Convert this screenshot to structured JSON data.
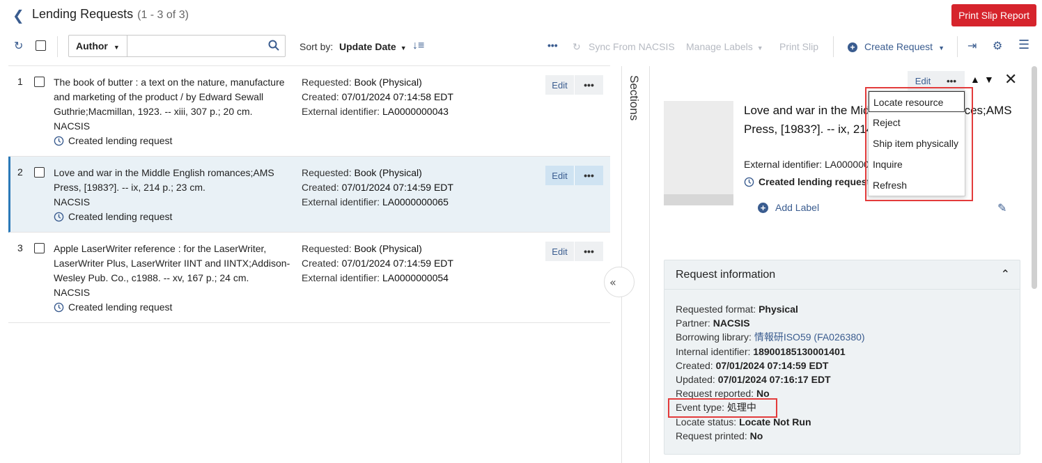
{
  "header": {
    "title": "Lending Requests",
    "count": "(1 - 3 of 3)",
    "print_report": "Print Slip Report"
  },
  "toolbar": {
    "search_field": "Author",
    "search_placeholder": "",
    "sort_label": "Sort by:",
    "sort_value": "Update Date",
    "sync": "Sync From NACSIS",
    "manage_labels": "Manage Labels",
    "print_slip": "Print Slip",
    "create_request": "Create Request"
  },
  "rows": [
    {
      "num": "1",
      "title": "The book of butter : a text on the nature, manufacture and marketing of the product / by Edward Sewall Guthrie;Macmillan, 1923. -- xiii, 307 p.; 20 cm.",
      "source": "NACSIS",
      "event": "Created lending request",
      "requested_label": "Requested:",
      "requested": "Book (Physical)",
      "created_label": "Created:",
      "created": "07/01/2024 07:14:58 EDT",
      "ext_label": "External identifier:",
      "ext": "LA0000000043",
      "edit": "Edit",
      "more": "•••"
    },
    {
      "num": "2",
      "title": "Love and war in the Middle English romances;AMS Press, [1983?]. -- ix, 214 p.; 23 cm.",
      "source": "NACSIS",
      "event": "Created lending request",
      "requested_label": "Requested:",
      "requested": "Book (Physical)",
      "created_label": "Created:",
      "created": "07/01/2024 07:14:59 EDT",
      "ext_label": "External identifier:",
      "ext": "LA0000000065",
      "edit": "Edit",
      "more": "•••"
    },
    {
      "num": "3",
      "title": "Apple LaserWriter reference : for the LaserWriter, LaserWriter Plus, LaserWriter IINT and IINTX;Addison-Wesley Pub. Co., c1988. -- xv, 167 p.; 24 cm.",
      "source": "NACSIS",
      "event": "Created lending request",
      "requested_label": "Requested:",
      "requested": "Book (Physical)",
      "created_label": "Created:",
      "created": "07/01/2024 07:14:59 EDT",
      "ext_label": "External identifier:",
      "ext": "LA0000000054",
      "edit": "Edit",
      "more": "•••"
    }
  ],
  "sections_label": "Sections",
  "detail": {
    "edit": "Edit",
    "more": "•••",
    "title": "Love and war in the Middle English romances;AMS Press, [1983?]. -- ix, 214 p.; 23 cm.",
    "ext_label": "External identifier:",
    "ext": "LA0000000065",
    "event": "Created lending request",
    "add_label": "Add Label",
    "request_info": {
      "heading": "Request information",
      "requested_format_label": "Requested format:",
      "requested_format": "Physical",
      "partner_label": "Partner:",
      "partner": "NACSIS",
      "borrowing_library_label": "Borrowing library:",
      "borrowing_library": "情報研ISO59 (FA026380)",
      "internal_id_label": "Internal identifier:",
      "internal_id": "18900185130001401",
      "created_label": "Created:",
      "created": "07/01/2024 07:14:59 EDT",
      "updated_label": "Updated:",
      "updated": "07/01/2024 07:16:17 EDT",
      "reported_label": "Request reported:",
      "reported": "No",
      "event_type_label": "Event type:",
      "event_type": "処理中",
      "locate_status_label": "Locate status:",
      "locate_status": "Locate Not Run",
      "printed_label": "Request printed:",
      "printed": "No"
    }
  },
  "menu": {
    "items": [
      "Locate resource",
      "Reject",
      "Ship item physically",
      "Inquire",
      "Refresh"
    ]
  },
  "colors": {
    "accent": "#3a5c8f",
    "primary_button": "#d6242c",
    "selected_row": "#e9f1f6",
    "highlight": "#e33b3b"
  }
}
